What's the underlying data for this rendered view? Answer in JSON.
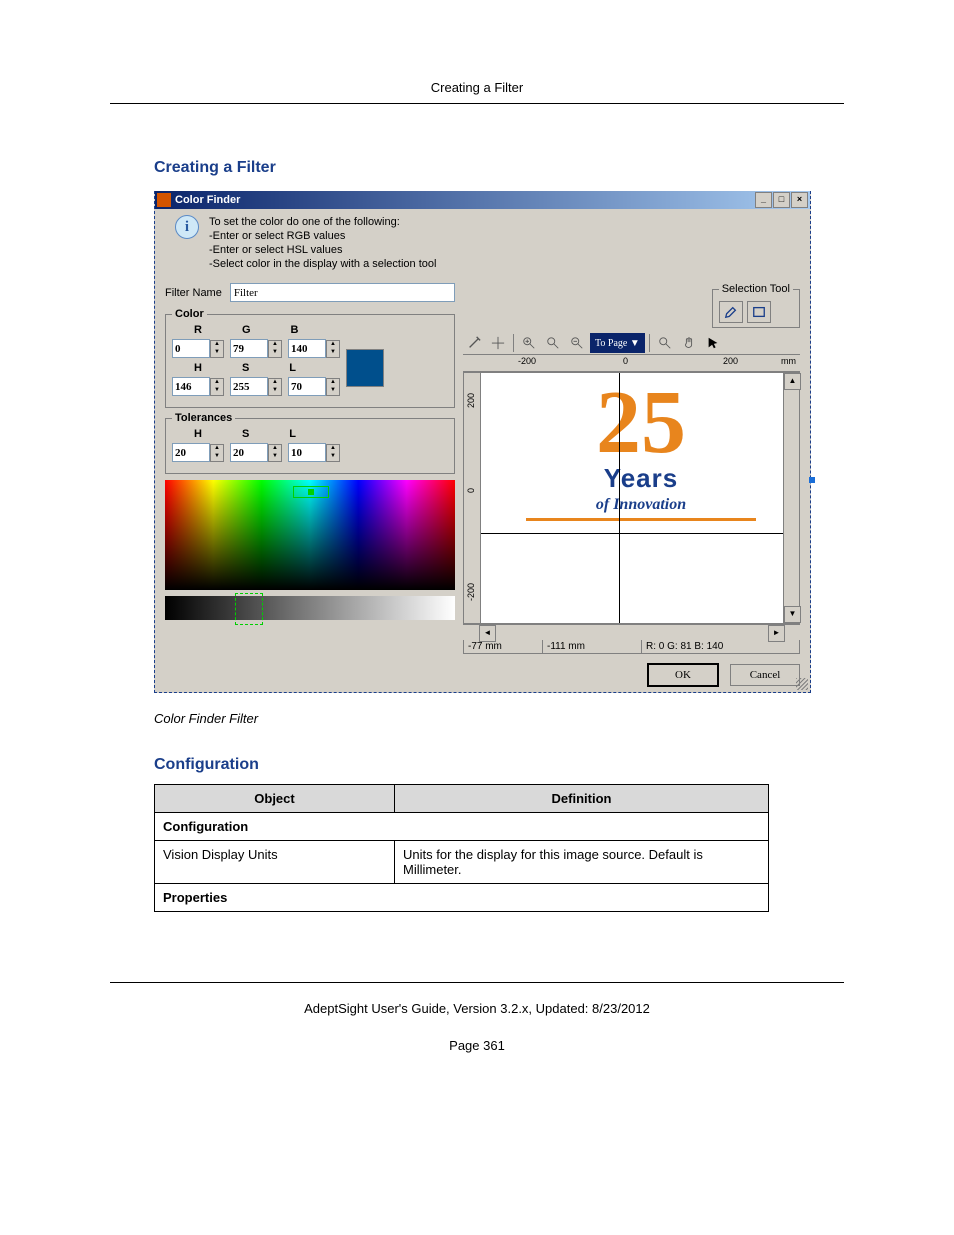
{
  "page": {
    "running_header": "Creating a Filter",
    "section_title": "Creating a Filter",
    "caption": "Color Finder Filter",
    "config_heading": "Configuration",
    "footer": "AdeptSight User's Guide,  Version 3.2.x, Updated: 8/23/2012",
    "page_number": "Page 361"
  },
  "dialog": {
    "title": "Color Finder",
    "win_min": "_",
    "win_max": "□",
    "win_close": "×",
    "info_l1": "To set the color do one of the following:",
    "info_l2": "-Enter or select RGB values",
    "info_l3": "-Enter or select HSL values",
    "info_l4": "-Select color in the display with a selection tool",
    "filter_name_label": "Filter Name",
    "filter_name_value": "Filter",
    "group_color": "Color",
    "lbl_R": "R",
    "lbl_G": "G",
    "lbl_B": "B",
    "val_R": "0",
    "val_G": "79",
    "val_B": "140",
    "lbl_H": "H",
    "lbl_S": "S",
    "lbl_L": "L",
    "val_H": "146",
    "val_S": "255",
    "val_L": "70",
    "group_tol": "Tolerances",
    "tol_H_lbl": "H",
    "tol_S_lbl": "S",
    "tol_L_lbl": "L",
    "tol_H": "20",
    "tol_S": "20",
    "tol_L": "10",
    "group_sel": "Selection Tool",
    "ruler_m200": "-200",
    "ruler_0": "0",
    "ruler_200": "200",
    "ruler_unit": "mm",
    "vruler_200": "200",
    "vruler_0": "0",
    "vruler_m200": "-200",
    "topage": "To Page",
    "logo_num": "25",
    "logo_years": "Years",
    "logo_innov": "of Innovation",
    "status_x": "-77 mm",
    "status_y": "-111 mm",
    "status_rgb": "R: 0 G: 81 B: 140",
    "btn_ok": "OK",
    "btn_cancel": "Cancel"
  },
  "table": {
    "h_object": "Object",
    "h_def": "Definition",
    "sec1": "Configuration",
    "r1_obj": "Vision Display Units",
    "r1_def": "Units for the display for this image source. Default is Millimeter.",
    "sec2": "Properties"
  }
}
